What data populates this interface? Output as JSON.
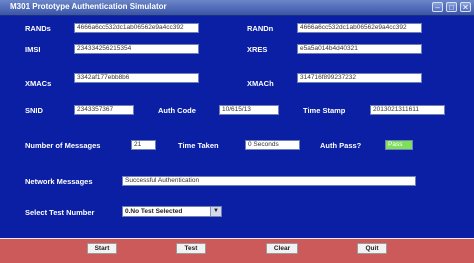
{
  "window": {
    "title": "M301 Prototype Authentication Simulator",
    "min": "–",
    "max": "□",
    "close": "✕"
  },
  "fields": {
    "rands_label": "RANDs",
    "rands_value": "4666a6cc532dc1ab06562e9a4cc392",
    "randn_label": "RANDn",
    "randn_value": "4666a6cc532dc1ab06562e9a4cc392",
    "imsi_label": "IMSI",
    "imsi_value": "234334256215354",
    "xres_label": "XRES",
    "xres_value": "e5a5a014b4d40321",
    "xmacs_label": "XMACs",
    "xmacs_value": "3342af177ebb8b6",
    "xmach_label": "XMACh",
    "xmach_value": "314716f899237232",
    "snid_label": "SNID",
    "snid_value": "2343357367",
    "authcode_label": "Auth Code",
    "authcode_value": "10/615/13",
    "timestamp_label": "Time Stamp",
    "timestamp_value": "2013021311611",
    "nummsg_label": "Number of Messages",
    "nummsg_value": "21",
    "timetaken_label": "Time Taken",
    "timetaken_value": "0 Seconds",
    "authpass_label": "Auth Pass?",
    "authpass_value": "Pass",
    "netmsg_label": "Network Messages",
    "netmsg_value": "Successful Authentication",
    "testnum_label": "Select Test Number",
    "testnum_value": "0.No Test Selected"
  },
  "buttons": {
    "start": "Start",
    "test": "Test",
    "clear": "Clear",
    "quit": "Quit"
  },
  "colors": {
    "background": "#0a1fa3",
    "bottom_bar": "#cc5a5a",
    "pass": "#7ee05a"
  }
}
